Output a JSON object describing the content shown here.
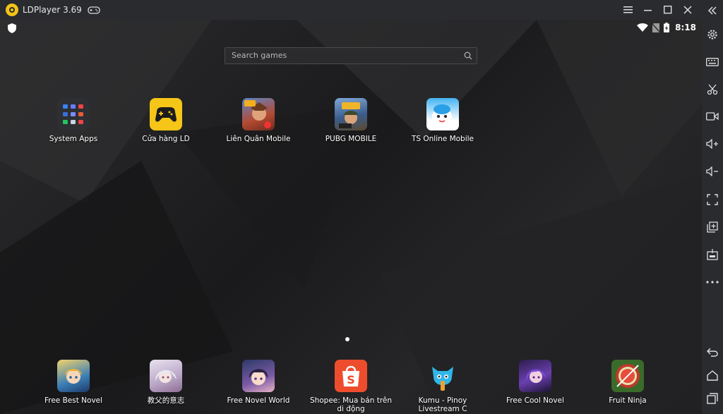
{
  "window": {
    "title": "LDPlayer 3.69"
  },
  "status": {
    "time": "8:18"
  },
  "search": {
    "placeholder": "Search games"
  },
  "home_apps": [
    {
      "label": "System Apps",
      "icon": "folder-grid-icon"
    },
    {
      "label": "Cửa hàng LD",
      "icon": "ld-store-gamepad-icon"
    },
    {
      "label": "Liên Quân Mobile",
      "icon": "lien-quan-icon"
    },
    {
      "label": "PUBG MOBILE",
      "icon": "pubg-icon"
    },
    {
      "label": "TS Online Mobile",
      "icon": "ts-online-icon"
    }
  ],
  "dock_apps": [
    {
      "label": "Free Best Novel",
      "icon": "novel-anime-icon"
    },
    {
      "label": "教父的意志",
      "icon": "anime-girl-icon"
    },
    {
      "label": "Free Novel World",
      "icon": "novel-world-icon"
    },
    {
      "label": "Shopee: Mua bán trên di động",
      "icon": "shopee-icon"
    },
    {
      "label": "Kumu - Pinoy Livestream C",
      "icon": "kumu-icon"
    },
    {
      "label": "Free Cool Novel",
      "icon": "cool-novel-icon"
    },
    {
      "label": "Fruit Ninja",
      "icon": "fruit-ninja-icon"
    }
  ],
  "sidebar": [
    "collapse-icon",
    "settings-icon",
    "keyboard-icon",
    "scissors-icon",
    "record-icon",
    "volume-up-icon",
    "volume-down-icon",
    "fullscreen-icon",
    "multi-instance-icon",
    "apk-install-icon",
    "more-icon",
    "back-icon",
    "home-icon",
    "recents-icon"
  ],
  "colors": {
    "accent": "#f2c318",
    "shopee": "#ee4d2d",
    "titlebar": "#2a2b2e"
  }
}
